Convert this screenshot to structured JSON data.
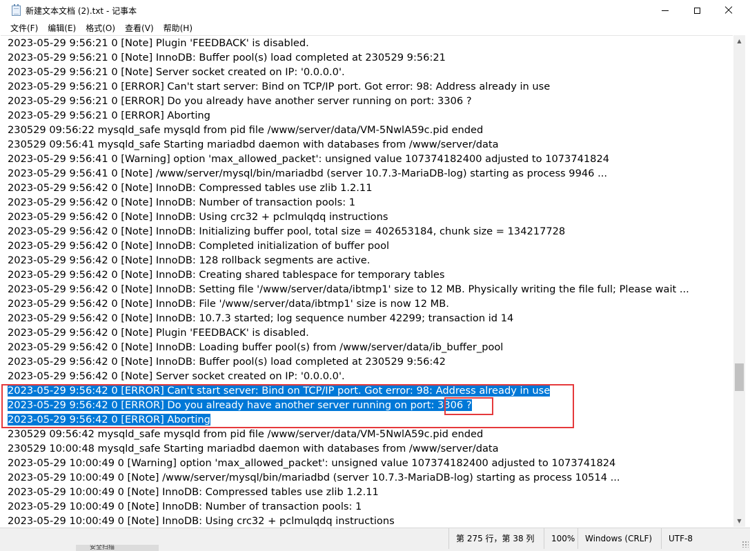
{
  "window": {
    "title": "新建文本文档 (2).txt - 记事本"
  },
  "menu": {
    "items": [
      "文件(F)",
      "编辑(E)",
      "格式(O)",
      "查看(V)",
      "帮助(H)"
    ]
  },
  "editor": {
    "lines": [
      "2023-05-29 9:56:21 0 [Note] Plugin 'FEEDBACK' is disabled.",
      "2023-05-29 9:56:21 0 [Note] InnoDB: Buffer pool(s) load completed at 230529 9:56:21",
      "2023-05-29 9:56:21 0 [Note] Server socket created on IP: '0.0.0.0'.",
      "2023-05-29 9:56:21 0 [ERROR] Can't start server: Bind on TCP/IP port. Got error: 98: Address already in use",
      "2023-05-29 9:56:21 0 [ERROR] Do you already have another server running on port: 3306 ?",
      "2023-05-29 9:56:21 0 [ERROR] Aborting",
      "230529 09:56:22 mysqld_safe mysqld from pid file /www/server/data/VM-5NwlA59c.pid ended",
      "230529 09:56:41 mysqld_safe Starting mariadbd daemon with databases from /www/server/data",
      "2023-05-29 9:56:41 0 [Warning] option 'max_allowed_packet': unsigned value 107374182400 adjusted to 1073741824",
      "2023-05-29 9:56:41 0 [Note] /www/server/mysql/bin/mariadbd (server 10.7.3-MariaDB-log) starting as process 9946 ...",
      "2023-05-29 9:56:42 0 [Note] InnoDB: Compressed tables use zlib 1.2.11",
      "2023-05-29 9:56:42 0 [Note] InnoDB: Number of transaction pools: 1",
      "2023-05-29 9:56:42 0 [Note] InnoDB: Using crc32 + pclmulqdq instructions",
      "2023-05-29 9:56:42 0 [Note] InnoDB: Initializing buffer pool, total size = 402653184, chunk size = 134217728",
      "2023-05-29 9:56:42 0 [Note] InnoDB: Completed initialization of buffer pool",
      "2023-05-29 9:56:42 0 [Note] InnoDB: 128 rollback segments are active.",
      "2023-05-29 9:56:42 0 [Note] InnoDB: Creating shared tablespace for temporary tables",
      "2023-05-29 9:56:42 0 [Note] InnoDB: Setting file '/www/server/data/ibtmp1' size to 12 MB. Physically writing the file full; Please wait ...",
      "2023-05-29 9:56:42 0 [Note] InnoDB: File '/www/server/data/ibtmp1' size is now 12 MB.",
      "2023-05-29 9:56:42 0 [Note] InnoDB: 10.7.3 started; log sequence number 42299; transaction id 14",
      "2023-05-29 9:56:42 0 [Note] Plugin 'FEEDBACK' is disabled.",
      "2023-05-29 9:56:42 0 [Note] InnoDB: Loading buffer pool(s) from /www/server/data/ib_buffer_pool",
      "2023-05-29 9:56:42 0 [Note] InnoDB: Buffer pool(s) load completed at 230529 9:56:42",
      "2023-05-29 9:56:42 0 [Note] Server socket created on IP: '0.0.0.0'.",
      "2023-05-29 9:56:42 0 [ERROR] Can't start server: Bind on TCP/IP port. Got error: 98: Address already in use",
      "2023-05-29 9:56:42 0 [ERROR] Do you already have another server running on port: 3306 ?",
      "2023-05-29 9:56:42 0 [ERROR] Aborting",
      "230529 09:56:42 mysqld_safe mysqld from pid file /www/server/data/VM-5NwlA59c.pid ended",
      "230529 10:00:48 mysqld_safe Starting mariadbd daemon with databases from /www/server/data",
      "2023-05-29 10:00:49 0 [Warning] option 'max_allowed_packet': unsigned value 107374182400 adjusted to 1073741824",
      "2023-05-29 10:00:49 0 [Note] /www/server/mysql/bin/mariadbd (server 10.7.3-MariaDB-log) starting as process 10514 ...",
      "2023-05-29 10:00:49 0 [Note] InnoDB: Compressed tables use zlib 1.2.11",
      "2023-05-29 10:00:49 0 [Note] InnoDB: Number of transaction pools: 1",
      "2023-05-29 10:00:49 0 [Note] InnoDB: Using crc32 + pclmulqdq instructions"
    ],
    "selected_lines": [
      24,
      25,
      26
    ]
  },
  "status": {
    "position": "第 275 行，第 38 列",
    "zoom": "100%",
    "line_ending": "Windows (CRLF)",
    "encoding": "UTF-8"
  },
  "taskbar_fragment": "安全扫描",
  "colors": {
    "selection": "#0078d7",
    "annotation": "#e5393b"
  }
}
